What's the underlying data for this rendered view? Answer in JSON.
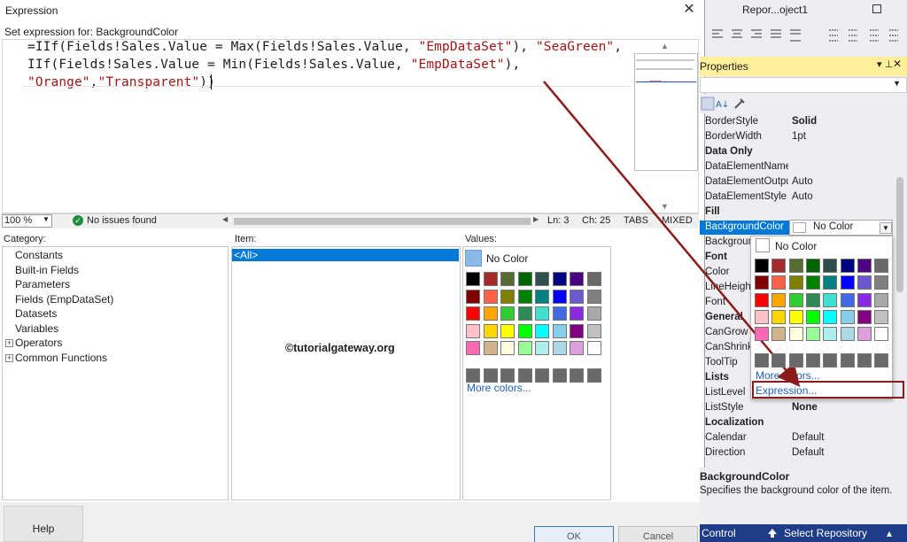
{
  "dialog": {
    "title": "Expression",
    "set_expression_label": "Set expression for: BackgroundColor",
    "code_lines": [
      [
        {
          "t": "=IIf(Fields!Sales.Value = Max(Fields!Sales.Value, ",
          "c": "n"
        },
        {
          "t": "\"EmpDataSet\"",
          "c": "s"
        },
        {
          "t": "), ",
          "c": "n"
        },
        {
          "t": "\"SeaGreen\"",
          "c": "s"
        },
        {
          "t": ",",
          "c": "n"
        }
      ],
      [
        {
          "t": "IIf(Fields!Sales.Value = Min(Fields!Sales.Value, ",
          "c": "n"
        },
        {
          "t": "\"EmpDataSet\"",
          "c": "s"
        },
        {
          "t": "),",
          "c": "n"
        }
      ],
      [
        {
          "t": "\"Orange\"",
          "c": "s"
        },
        {
          "t": ",",
          "c": "n"
        },
        {
          "t": "\"Transparent\"",
          "c": "s"
        },
        {
          "t": "))",
          "c": "n"
        }
      ]
    ],
    "status": {
      "zoom": "100 %",
      "issues": "No issues found",
      "line": "Ln: 3",
      "col": "Ch: 25",
      "tabs": "TABS",
      "mixed": "MIXED"
    },
    "category_label": "Category:",
    "item_label": "Item:",
    "values_label": "Values:",
    "categories": [
      {
        "label": "Constants",
        "expandable": false
      },
      {
        "label": "Built-in Fields",
        "expandable": false
      },
      {
        "label": "Parameters",
        "expandable": false
      },
      {
        "label": "Fields (EmpDataSet)",
        "expandable": false
      },
      {
        "label": "Datasets",
        "expandable": false
      },
      {
        "label": "Variables",
        "expandable": false
      },
      {
        "label": "Operators",
        "expandable": true
      },
      {
        "label": "Common Functions",
        "expandable": true
      }
    ],
    "items": [
      "<All>"
    ],
    "watermark": "©tutorialgateway.org",
    "no_color_label": "No Color",
    "more_colors": "More colors...",
    "help_button": "Help",
    "ok_button": "OK",
    "cancel_button": "Cancel"
  },
  "palette": [
    [
      "#000000",
      "#a52a2a",
      "#556b2f",
      "#006400",
      "#2f4f4f",
      "#000080",
      "#4b0082",
      "#696969"
    ],
    [
      "#800000",
      "#ff6347",
      "#808000",
      "#008000",
      "#008080",
      "#0000ff",
      "#6a5acd",
      "#808080"
    ],
    [
      "#ff0000",
      "#ffa500",
      "#32cd32",
      "#2e8b57",
      "#40e0d0",
      "#4169e1",
      "#8a2be2",
      "#a9a9a9"
    ],
    [
      "#ffc0cb",
      "#ffd700",
      "#ffff00",
      "#00ff00",
      "#00ffff",
      "#87ceeb",
      "#800080",
      "#c0c0c0"
    ],
    [
      "#ff69b4",
      "#d2b48c",
      "#ffffe0",
      "#98fb98",
      "#afeeee",
      "#add8e6",
      "#dda0dd",
      "#ffffff"
    ],
    [
      "#696969",
      "#696969",
      "#696969",
      "#696969",
      "#696969",
      "#696969",
      "#696969",
      "#696969"
    ]
  ],
  "vs": {
    "doc_title": "Repor...oject1",
    "properties_title": "Properties",
    "rows": [
      {
        "name": "BorderStyle",
        "value": "Solid",
        "bold": true
      },
      {
        "name": "BorderWidth",
        "value": "1pt"
      },
      {
        "cat": "Data Only"
      },
      {
        "name": "DataElementName",
        "value": ""
      },
      {
        "name": "DataElementOutput",
        "value": "Auto"
      },
      {
        "name": "DataElementStyle",
        "value": "Auto"
      },
      {
        "cat": "Fill"
      },
      {
        "name": "",
        "value": ""
      },
      {
        "name": "BackgroundImage",
        "value": ""
      },
      {
        "cat": "Font"
      },
      {
        "name": "Color",
        "value": ""
      },
      {
        "name": "LineHeight",
        "value": ""
      },
      {
        "name": "Font",
        "value": ""
      },
      {
        "cat": "General"
      },
      {
        "name": "CanGrow",
        "value": ""
      },
      {
        "name": "CanShrink",
        "value": ""
      },
      {
        "name": "ToolTip",
        "value": ""
      },
      {
        "cat": "Lists"
      },
      {
        "name": "ListLevel",
        "value": ""
      },
      {
        "name": "ListStyle",
        "value": "None",
        "bold": true
      },
      {
        "cat": "Localization"
      },
      {
        "name": "Calendar",
        "value": "Default"
      },
      {
        "name": "Direction",
        "value": "Default"
      }
    ],
    "bg_name": "BackgroundColor",
    "bg_value": "No Color",
    "popup_no_color": "No Color",
    "popup_more_colors": "More colors...",
    "popup_expression": "Expression...",
    "desc_title": "BackgroundColor",
    "desc_text": "Specifies the background color of the item.",
    "team_control": "Control",
    "select_repository": "Select Repository"
  }
}
